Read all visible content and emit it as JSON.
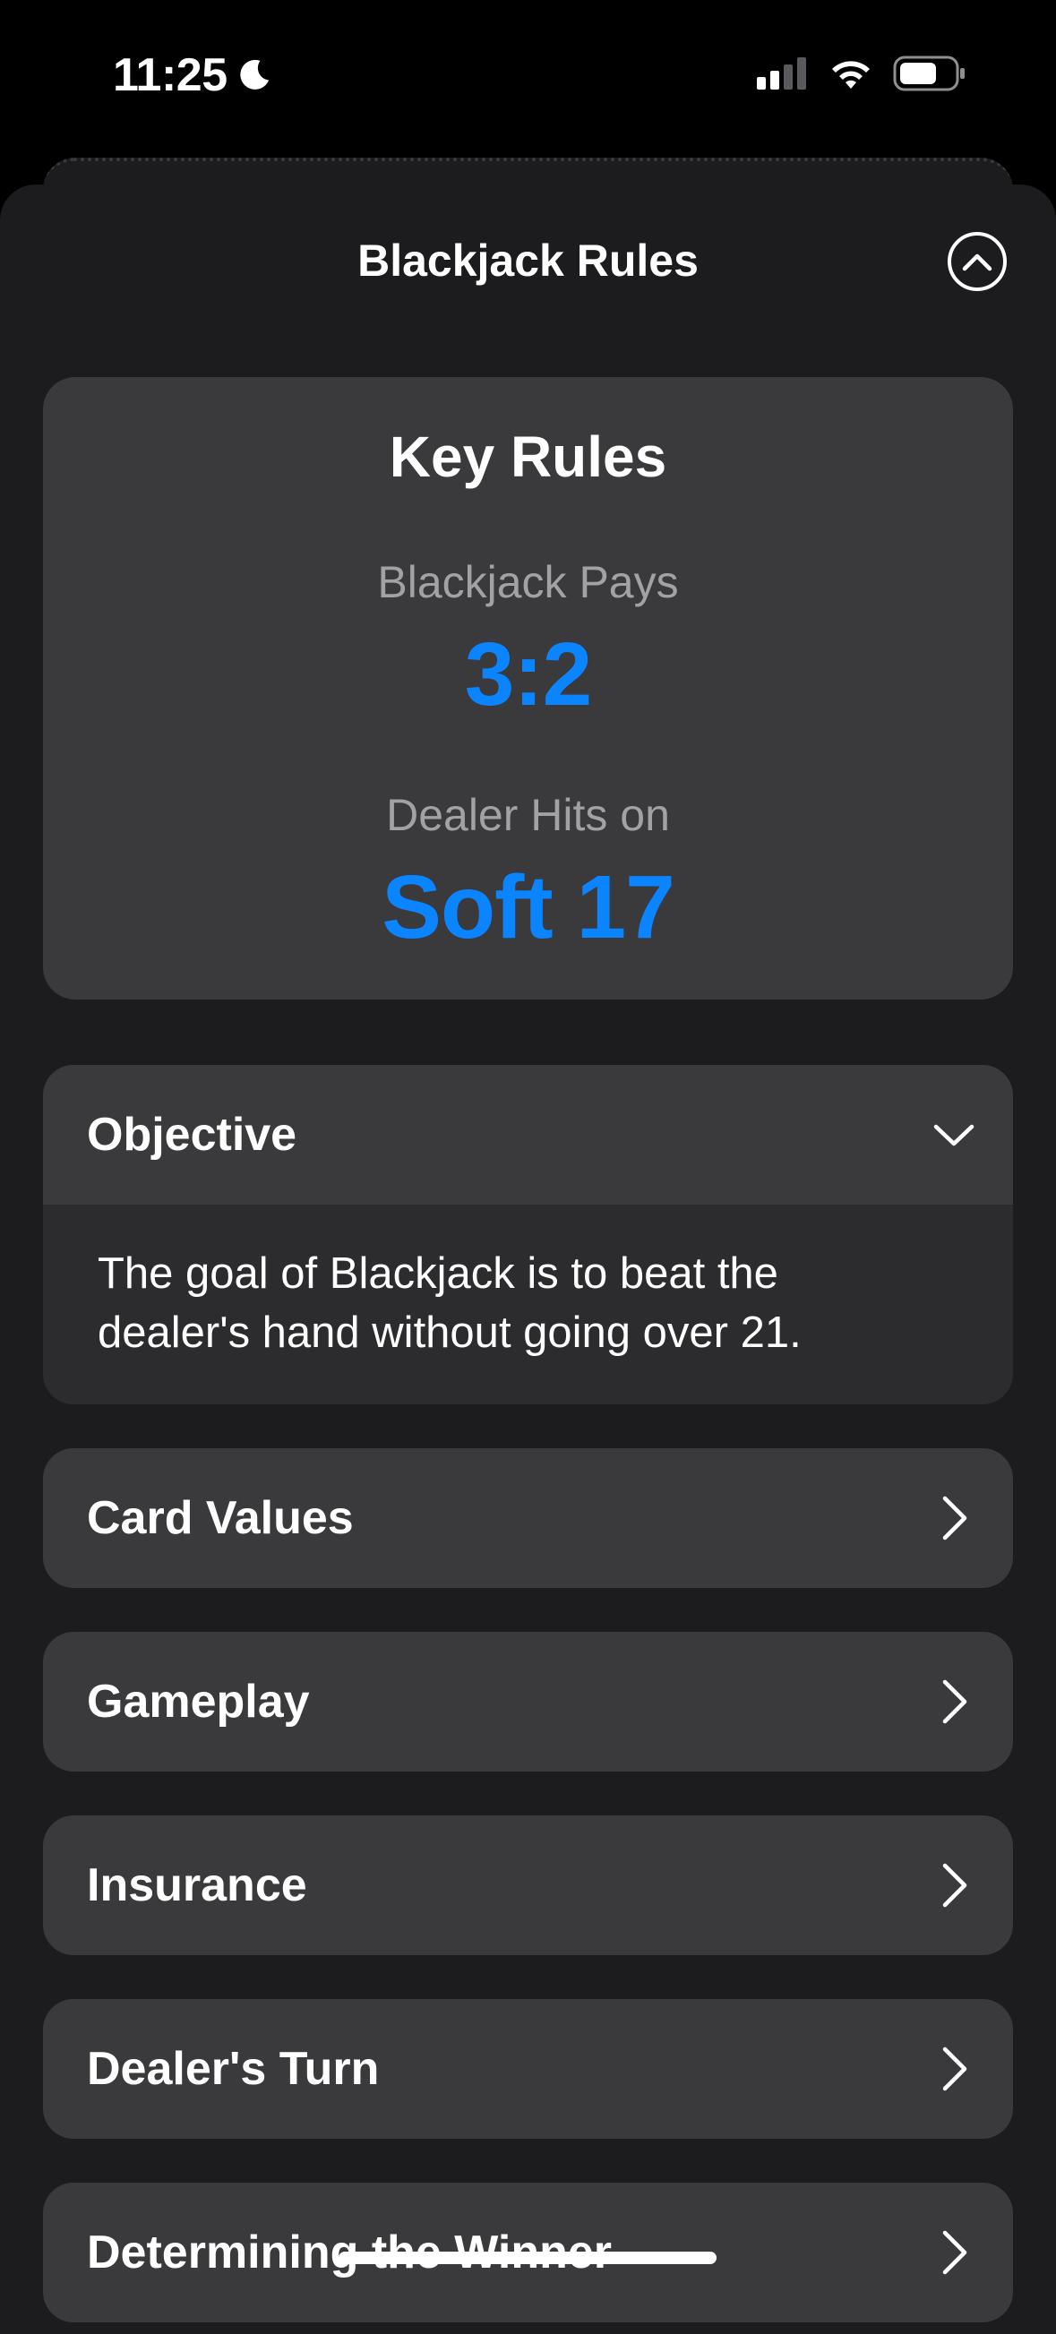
{
  "status": {
    "time": "11:25",
    "icons": [
      "moon-icon",
      "cellular-signal-icon",
      "wifi-icon",
      "battery-icon"
    ]
  },
  "sheet": {
    "title": "Blackjack Rules"
  },
  "key_rules": {
    "title": "Key Rules",
    "payout_label": "Blackjack Pays",
    "payout_value": "3:2",
    "dealer_label": "Dealer Hits on",
    "dealer_value": "Soft 17"
  },
  "sections": [
    {
      "label": "Objective",
      "expanded": true,
      "body": "The goal of Blackjack is to beat the dealer's hand without going over 21."
    },
    {
      "label": "Card Values",
      "expanded": false
    },
    {
      "label": "Gameplay",
      "expanded": false
    },
    {
      "label": "Insurance",
      "expanded": false
    },
    {
      "label": "Dealer's Turn",
      "expanded": false
    },
    {
      "label": "Determining the Winner",
      "expanded": false
    }
  ],
  "colors": {
    "accent": "#0a84ff",
    "background": "#1c1c1e",
    "card": "#3a3a3c",
    "secondary_text": "#a1a1a6"
  }
}
